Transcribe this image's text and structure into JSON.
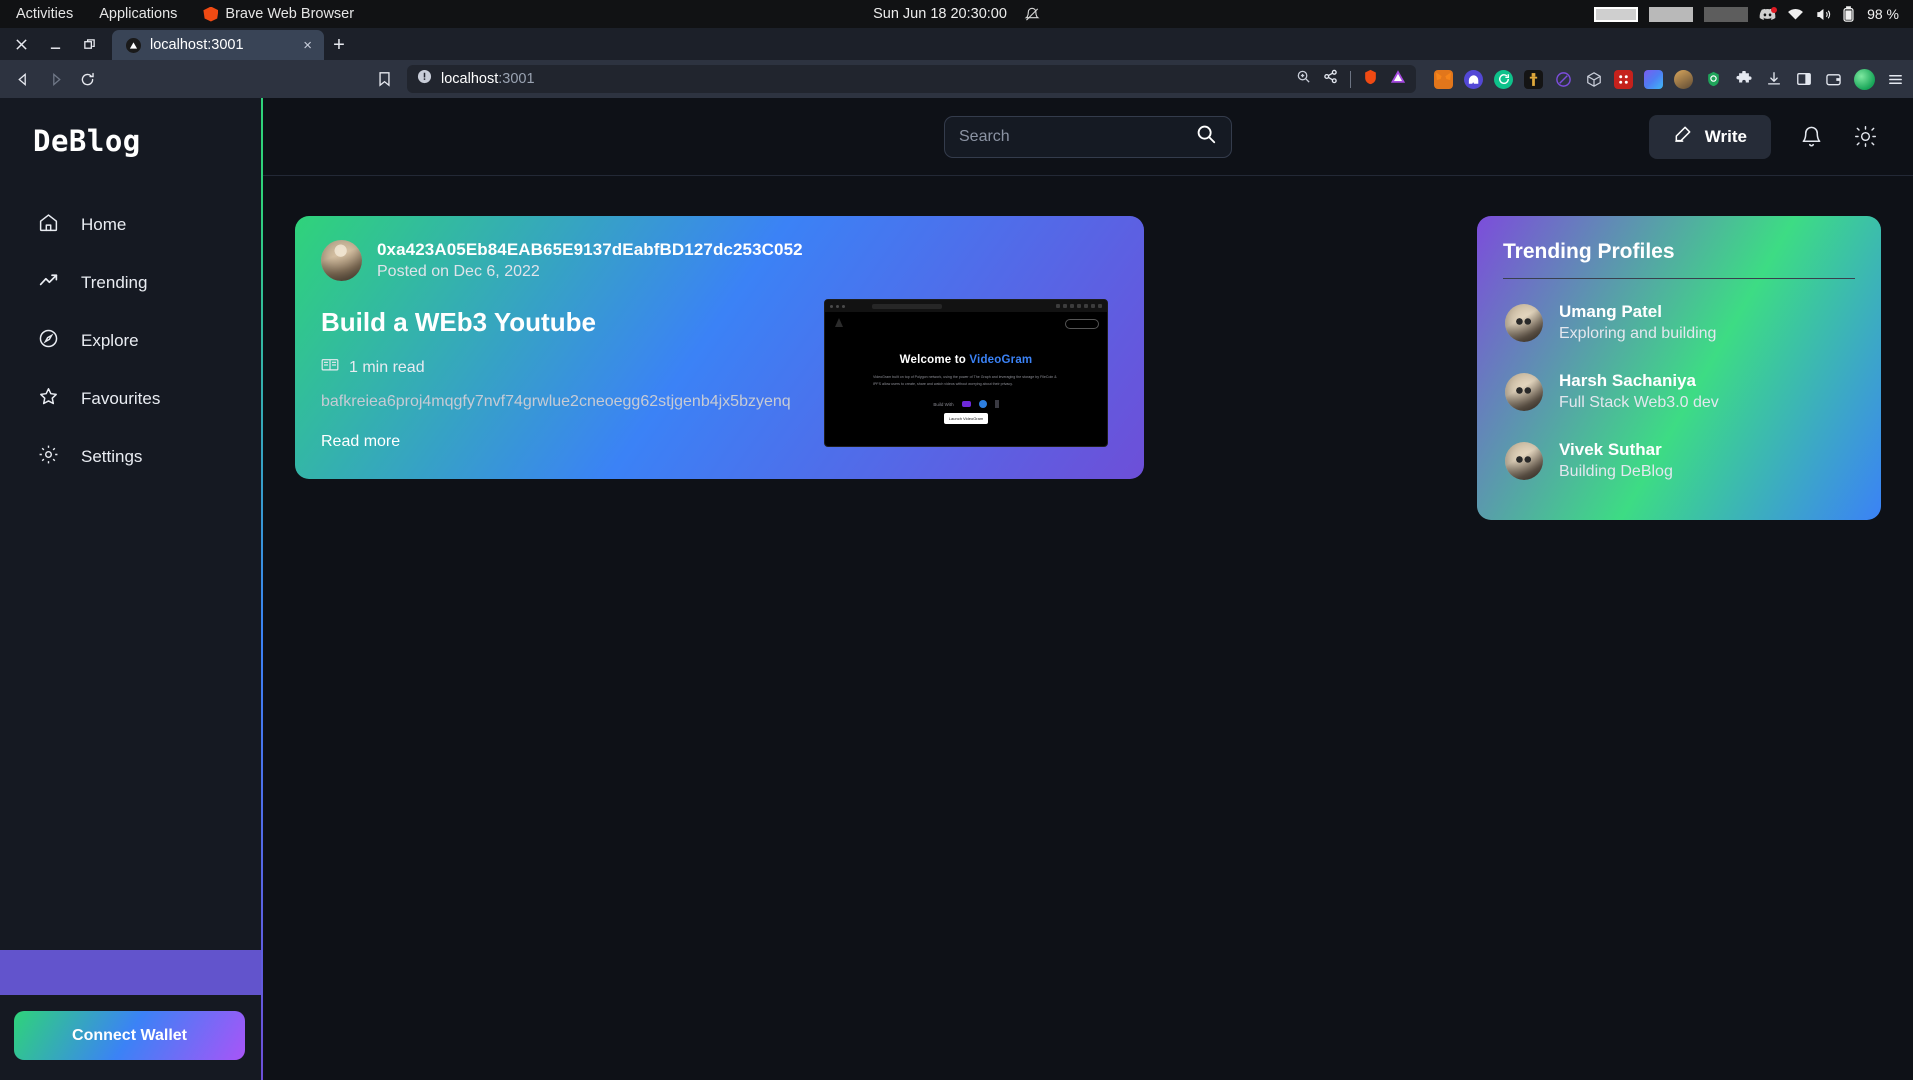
{
  "os_bar": {
    "activities": "Activities",
    "applications": "Applications",
    "app_name": "Brave Web Browser",
    "app_icon": "brave-lion-icon",
    "clock": "Sun Jun 18  20:30:00",
    "notification_icon": "bell-muted-icon",
    "tray": {
      "workspaces": [
        "workspace-1",
        "workspace-2",
        "workspace-3"
      ],
      "discord_icon": "discord-icon",
      "wifi_icon": "wifi-icon",
      "volume_icon": "volume-icon",
      "battery_icon": "battery-icon",
      "battery_level": "98 %"
    }
  },
  "browser": {
    "window_controls": [
      "close",
      "minimize",
      "restore"
    ],
    "tab": {
      "title": "localhost:3001",
      "favicon": "triangle-favicon",
      "close": "×"
    },
    "new_tab": "+",
    "nav": {
      "back": "back-icon",
      "forward": "forward-icon",
      "reload": "reload-icon",
      "bookmark": "bookmark-icon"
    },
    "url": {
      "scheme_icon": "info-circle-icon",
      "host": "localhost",
      "port": ":3001"
    },
    "url_actions": [
      "zoom-in-icon",
      "share-icon",
      "brave-shield-icon",
      "brave-rewards-icon"
    ],
    "extensions": [
      "metamask-icon",
      "phantom-icon",
      "green-circle-icon",
      "keplr-icon",
      "purple-ring-icon",
      "cube-icon",
      "red-grid-icon",
      "gradient-square-icon",
      "avatar-icon",
      "green-shield-icon",
      "puzzle-icon",
      "download-icon",
      "sidebar-icon",
      "wallet-icon",
      "profile-circle-icon",
      "menu-icon"
    ]
  },
  "sidebar": {
    "brand": "DeBlog",
    "items": [
      {
        "label": "Home",
        "icon": "home-icon"
      },
      {
        "label": "Trending",
        "icon": "trending-up-icon"
      },
      {
        "label": "Explore",
        "icon": "compass-icon"
      },
      {
        "label": "Favourites",
        "icon": "star-icon"
      },
      {
        "label": "Settings",
        "icon": "gear-icon"
      }
    ],
    "connect_wallet": "Connect Wallet"
  },
  "header": {
    "search_placeholder": "Search",
    "search_value": "",
    "search_icon": "search-icon",
    "write_label": "Write",
    "write_icon": "pencil-square-icon",
    "notifications_icon": "bell-icon",
    "theme_icon": "sun-icon"
  },
  "feed": {
    "posts": [
      {
        "author": "0xa423A05Eb84EAB65E9137dEabfBD127dc253C052",
        "posted_on": "Posted on Dec 6, 2022",
        "title": "Build a WEb3 Youtube",
        "read_time": "1 min read",
        "read_time_icon": "book-icon",
        "cid": "bafkreiea6proj4mqgfy7nvf74grwlue2cneoegg62stjgenb4jx5bzyenq",
        "read_more": "Read more",
        "thumbnail": {
          "headline_plain": "Welcome to ",
          "headline_accent": "VideoGram",
          "paragraph": "VideoGram built on top of Polygon network, using the power of The Graph and leveraging the storage by FileCoin & IPFS allow users to create, share and watch videos without worrying about their privacy.",
          "built_with_label": "Build With",
          "button_label": "Launch VideoGram",
          "connect_label": "Connect"
        }
      }
    ]
  },
  "trending": {
    "title": "Trending Profiles",
    "profiles": [
      {
        "name": "Umang Patel",
        "bio": "Exploring and building"
      },
      {
        "name": "Harsh Sachaniya",
        "bio": "Full Stack Web3.0 dev"
      },
      {
        "name": "Vivek Suthar",
        "bio": "Building DeBlog"
      }
    ]
  },
  "colors": {
    "accent_green": "#2fd37a",
    "accent_blue": "#3b82f6",
    "accent_purple": "#6d4fd8",
    "sidebar_band": "#6254cc",
    "page_bg": "#0e1117"
  }
}
